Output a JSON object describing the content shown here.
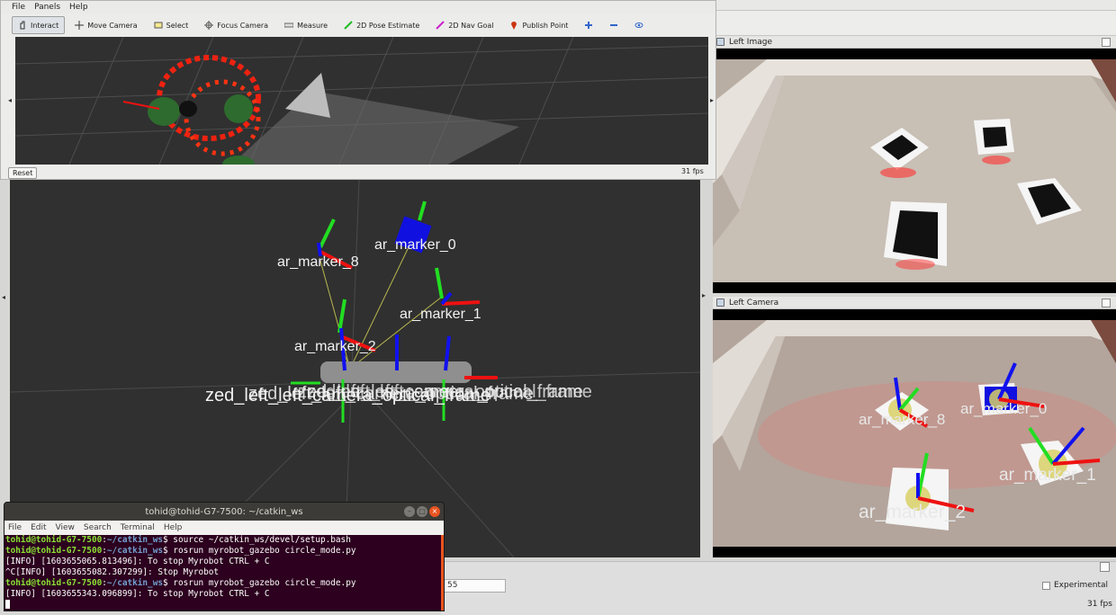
{
  "rviz": {
    "menu": [
      "File",
      "Panels",
      "Help"
    ],
    "tools": [
      {
        "label": "Interact",
        "icon": "interact-icon",
        "active": true
      },
      {
        "label": "Move Camera",
        "icon": "move-camera-icon"
      },
      {
        "label": "Select",
        "icon": "select-icon"
      },
      {
        "label": "Focus Camera",
        "icon": "focus-camera-icon"
      },
      {
        "label": "Measure",
        "icon": "measure-icon"
      },
      {
        "label": "2D Pose Estimate",
        "icon": "pose-estimate-icon"
      },
      {
        "label": "2D Nav Goal",
        "icon": "nav-goal-icon"
      },
      {
        "label": "Publish Point",
        "icon": "publish-point-icon"
      }
    ],
    "reset_label": "Reset",
    "fps": "31 fps"
  },
  "main_view": {
    "markers": [
      "ar_marker_8",
      "ar_marker_0",
      "ar_marker_1",
      "ar_marker_2"
    ],
    "base_label": "zed_left_left_camera_optical_frame"
  },
  "panels": {
    "left_image": {
      "title": "Left Image"
    },
    "left_camera": {
      "title": "Left Camera",
      "labels": [
        "ar_marker_8",
        "ar_marker_0",
        "ar_marker_1",
        "ar_marker_2"
      ]
    }
  },
  "bottom": {
    "field_value": "55",
    "experimental_label": "Experimental",
    "fps": "31 fps"
  },
  "terminal": {
    "title": "tohid@tohid-G7-7500: ~/catkin_ws",
    "menu": [
      "File",
      "Edit",
      "View",
      "Search",
      "Terminal",
      "Help"
    ],
    "user": "tohid@tohid-G7-7500",
    "path": "~/catkin_ws",
    "cmd1": " source ~/catkin_ws/devel/setup.bash",
    "cmd2": " rosrun myrobot_gazebo circle_mode.py",
    "out1": "[INFO] [1603655065.813496]: To stop Myrobot CTRL + C",
    "out2": "^C[INFO] [1603655082.307299]: Stop Myrobot",
    "cmd3": " rosrun myrobot_gazebo circle_mode.py",
    "out3": "[INFO] [1603655343.096899]: To stop Myrobot CTRL + C"
  },
  "colors": {
    "view_bg": "#303030",
    "terminal_bg": "#2c001e",
    "prompt_green": "#8ae234",
    "prompt_blue": "#729fcf",
    "ubuntu_orange": "#e95420"
  }
}
